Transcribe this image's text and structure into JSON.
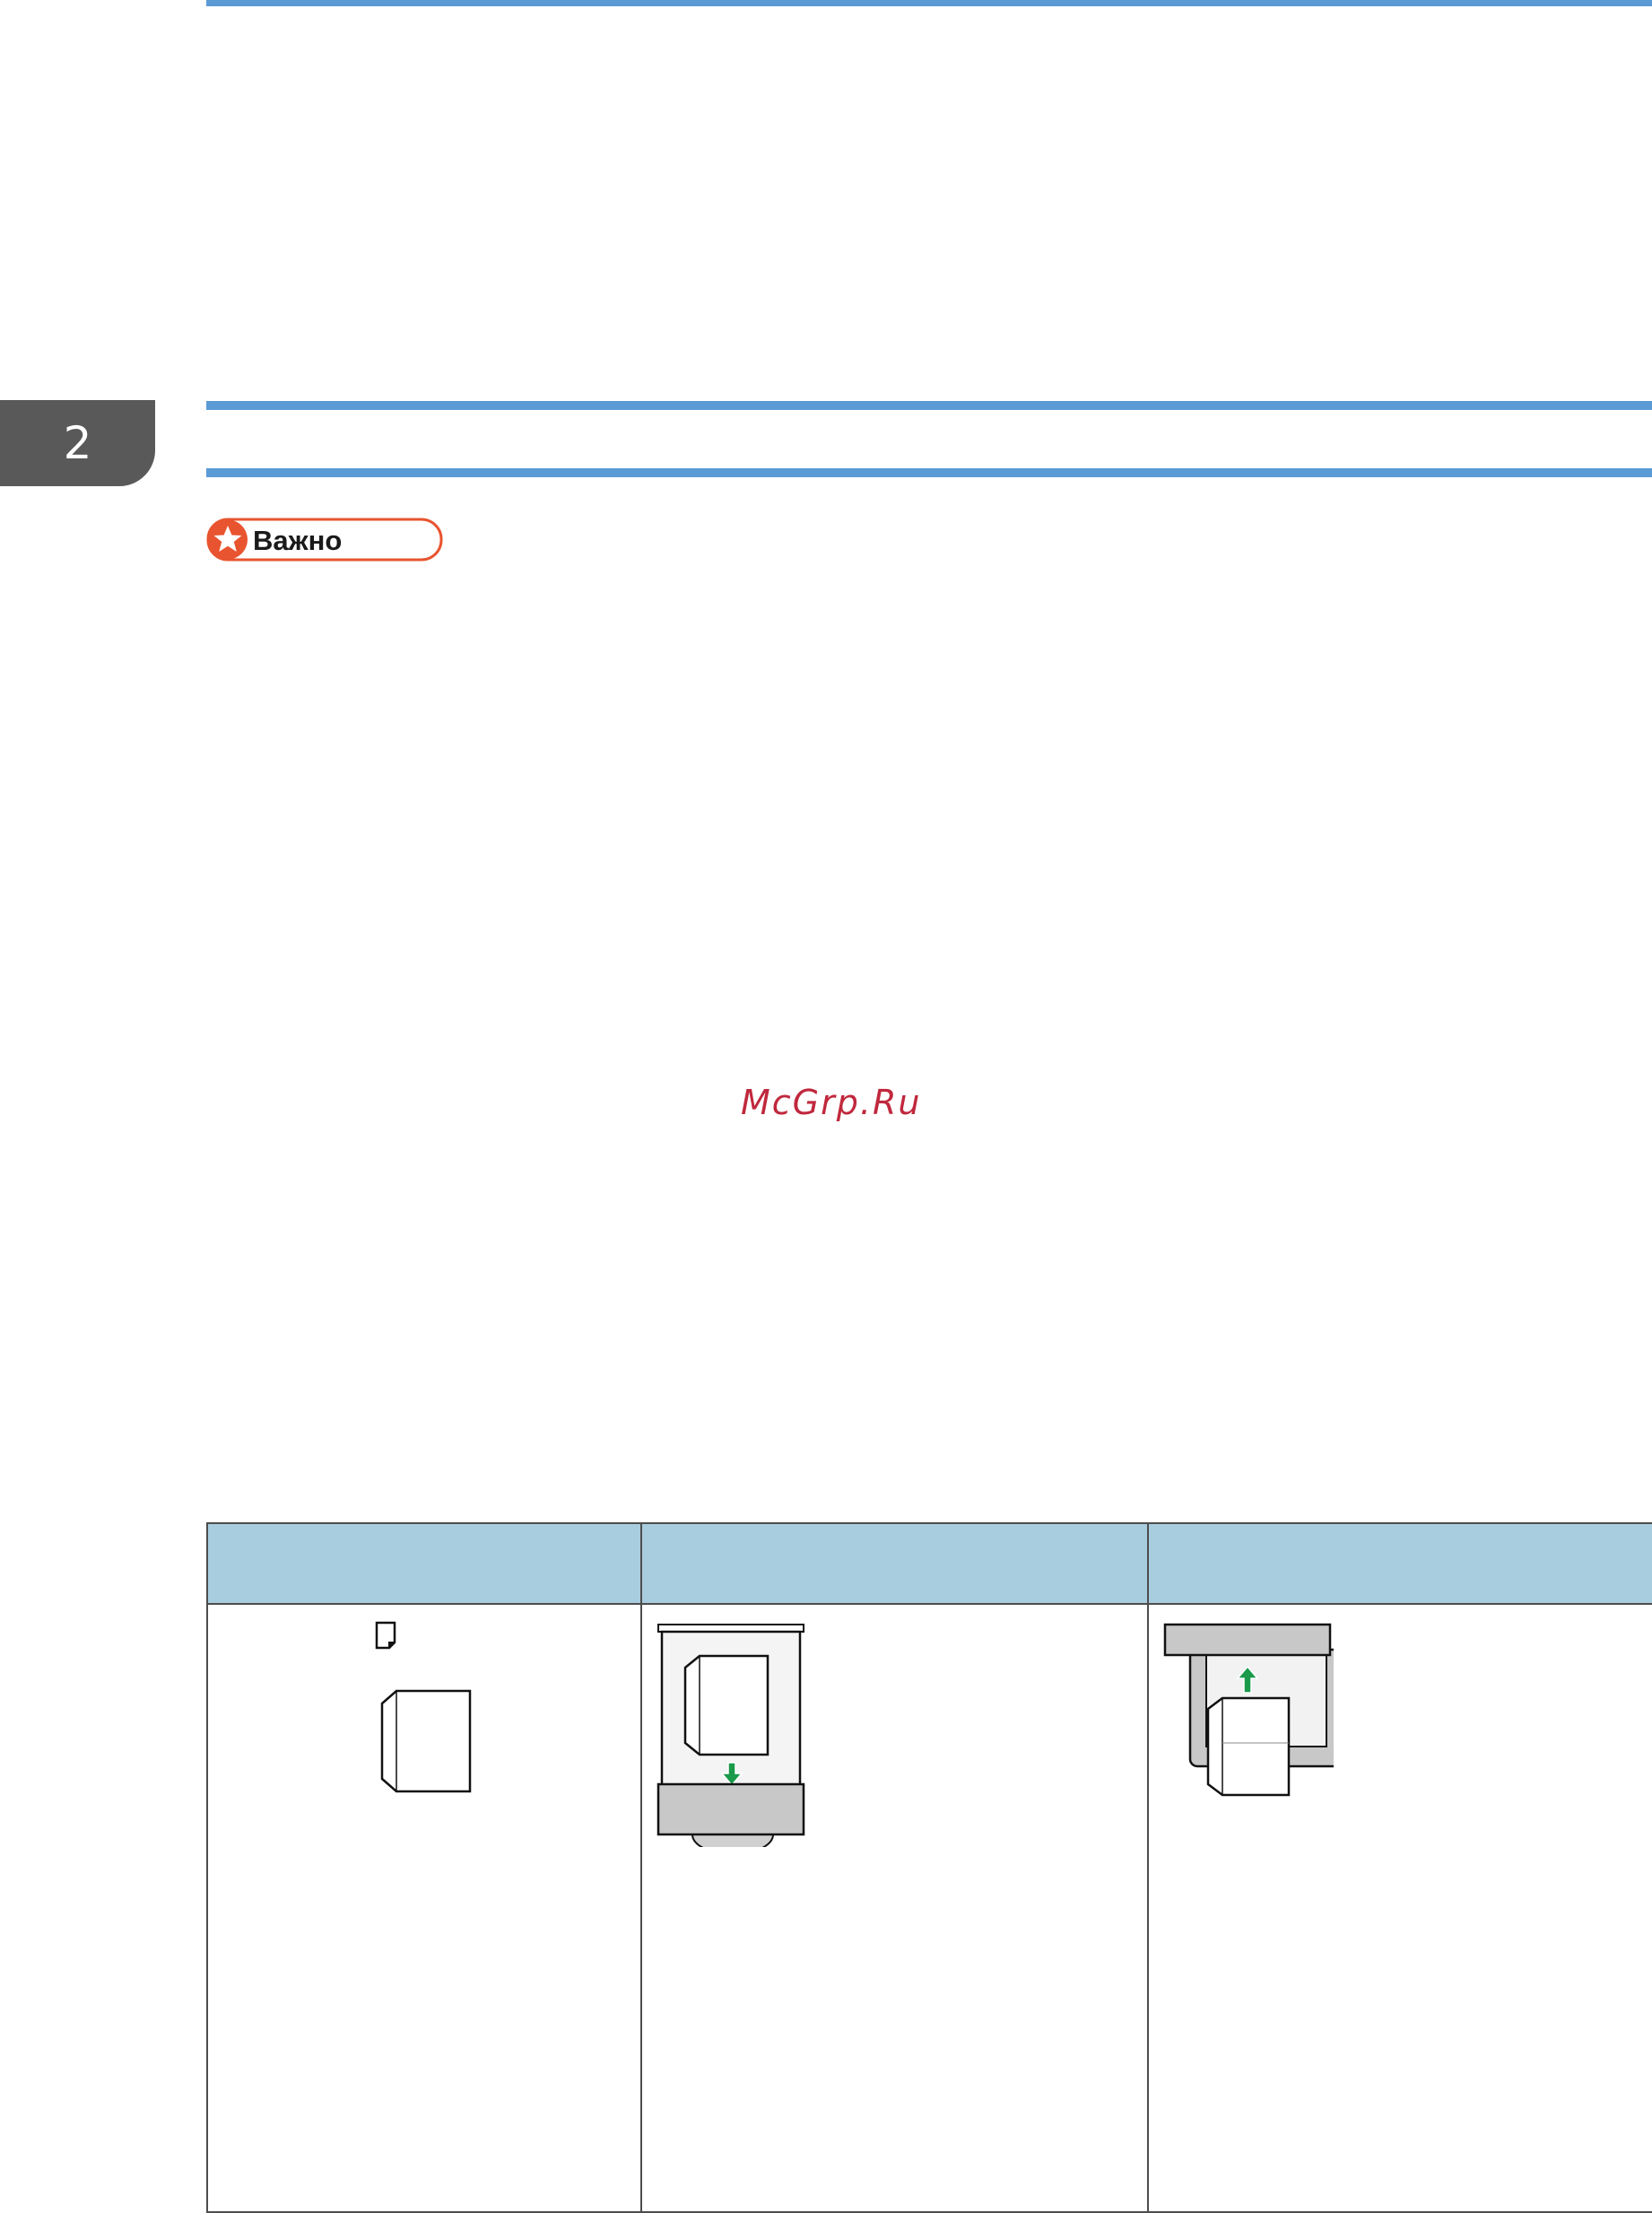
{
  "chapter": {
    "number": "2"
  },
  "important_badge": {
    "label": "Важно",
    "icon": "star-icon",
    "color": "#e8542f"
  },
  "watermark": {
    "text": "McGrp.Ru"
  },
  "table": {
    "header_color": "#a8cddf",
    "columns": [
      {
        "header": ""
      },
      {
        "header": ""
      },
      {
        "header": ""
      }
    ],
    "row": {
      "cells": [
        {
          "icon": "envelope-orientation-icon",
          "text": ""
        },
        {
          "icon": "paper-tray-loading-icon",
          "text": ""
        },
        {
          "icon": "bypass-tray-loading-icon",
          "text": ""
        }
      ]
    },
    "arrow_color": "#1a9a4a"
  },
  "colors": {
    "rule": "#5b9bd5",
    "tab": "#595959"
  }
}
